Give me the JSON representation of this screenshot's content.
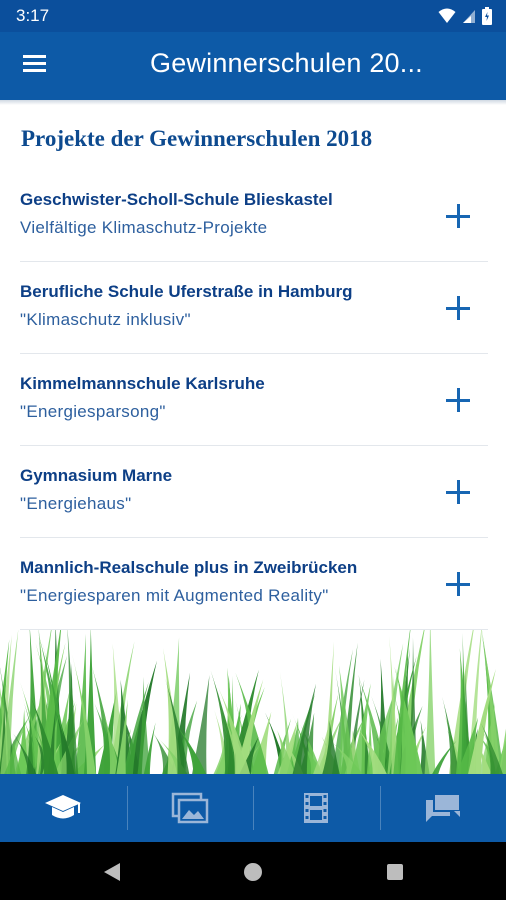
{
  "status_bar": {
    "time": "3:17",
    "icons": [
      "wifi-icon",
      "signal-icon",
      "battery-icon"
    ]
  },
  "app_bar": {
    "title": "Gewinnerschulen 20...",
    "menu_icon": "hamburger-menu-icon"
  },
  "section_title": "Projekte der Gewinnerschulen 2018",
  "schools": [
    {
      "name": "Geschwister-Scholl-Schule Blieskastel",
      "project": "Vielfältige Klimaschutz-Projekte"
    },
    {
      "name": "Berufliche Schule Uferstraße in Hamburg",
      "project": "\"Klimaschutz inklusiv\""
    },
    {
      "name": "Kimmelmannschule Karlsruhe",
      "project": "\"Energiesparsong\""
    },
    {
      "name": "Gymnasium Marne",
      "project": "\"Energiehaus\""
    },
    {
      "name": "Mannlich-Realschule plus in Zweibrücken",
      "project": "\"Energiesparen mit Augmented Reality\""
    }
  ],
  "bottom_nav": {
    "tabs": [
      {
        "icon": "graduation-cap-icon",
        "active": true
      },
      {
        "icon": "photo-gallery-icon",
        "active": false
      },
      {
        "icon": "film-icon",
        "active": false
      },
      {
        "icon": "chat-bubbles-icon",
        "active": false
      }
    ]
  },
  "colors": {
    "primary": "#0d5aa7",
    "status_bar": "#0b4f9c",
    "heading": "#0d4a8f",
    "school_name": "#0d3f86",
    "project_text": "#2d5f9e",
    "grass": "#4caf3c"
  }
}
